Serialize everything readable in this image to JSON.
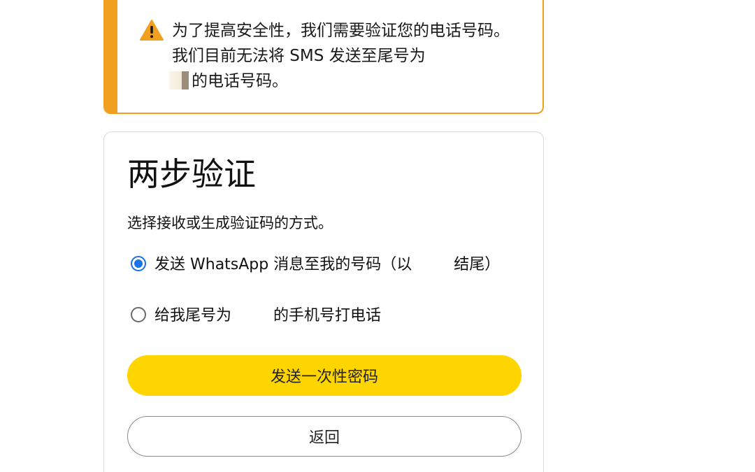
{
  "alert": {
    "icon": "warning-icon",
    "accent_color": "#f0a01e",
    "text_before": "为了提高安全性，我们需要验证您的电话号码。我们目前无法将 SMS 发送至尾号为",
    "text_after": "的电话号码。"
  },
  "card": {
    "title": "两步验证",
    "subtitle": "选择接收或生成验证码的方式。",
    "options": [
      {
        "label_before": "发送 WhatsApp 消息至我的号码（以",
        "label_after": "结尾）",
        "checked": true
      },
      {
        "label_before": "给我尾号为",
        "label_after": "的手机号打电话",
        "checked": false
      }
    ],
    "primary_button": "发送一次性密码",
    "secondary_button": "返回",
    "primary_color": "#ffd500",
    "radio_checked_color": "#1a73e8"
  }
}
